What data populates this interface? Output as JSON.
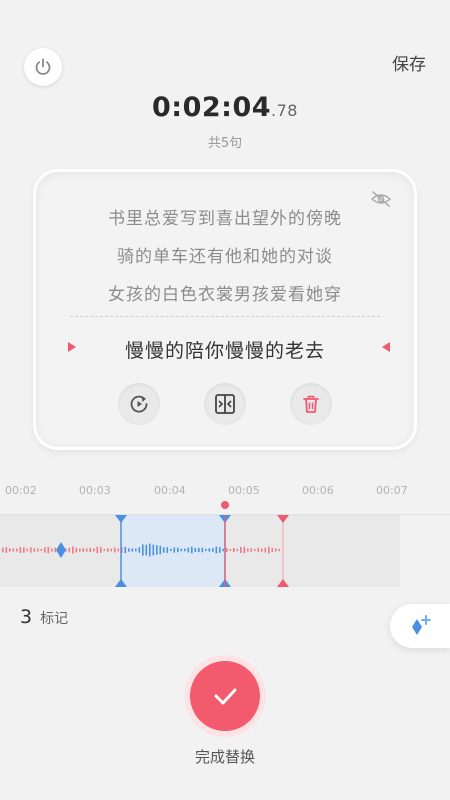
{
  "header": {
    "save_label": "保存",
    "timer_main": "0:02:04",
    "timer_ms": ".78",
    "sentence_count": "共5句"
  },
  "lyrics": {
    "lines": [
      "书里总爱写到喜出望外的傍晚",
      "骑的单车还有他和她的对谈",
      "女孩的白色衣裳男孩爱看她穿"
    ],
    "current_line": "慢慢的陪你慢慢的老去"
  },
  "timeline": {
    "ticks": [
      "00:02",
      "00:03",
      "00:04",
      "00:05",
      "00:06",
      "00:07"
    ]
  },
  "marks": {
    "count": "3",
    "label": "标记"
  },
  "footer": {
    "done_label": "完成替换"
  },
  "colors": {
    "accent_red": "#f25a6e",
    "accent_blue": "#4a90e2",
    "background": "#f2f2f2"
  },
  "icons": {
    "power": "power-icon",
    "hide": "eye-off-icon",
    "replay": "replay-icon",
    "split": "split-icon",
    "delete": "trash-icon",
    "add_mark": "add-mark-icon",
    "done": "check-icon"
  }
}
